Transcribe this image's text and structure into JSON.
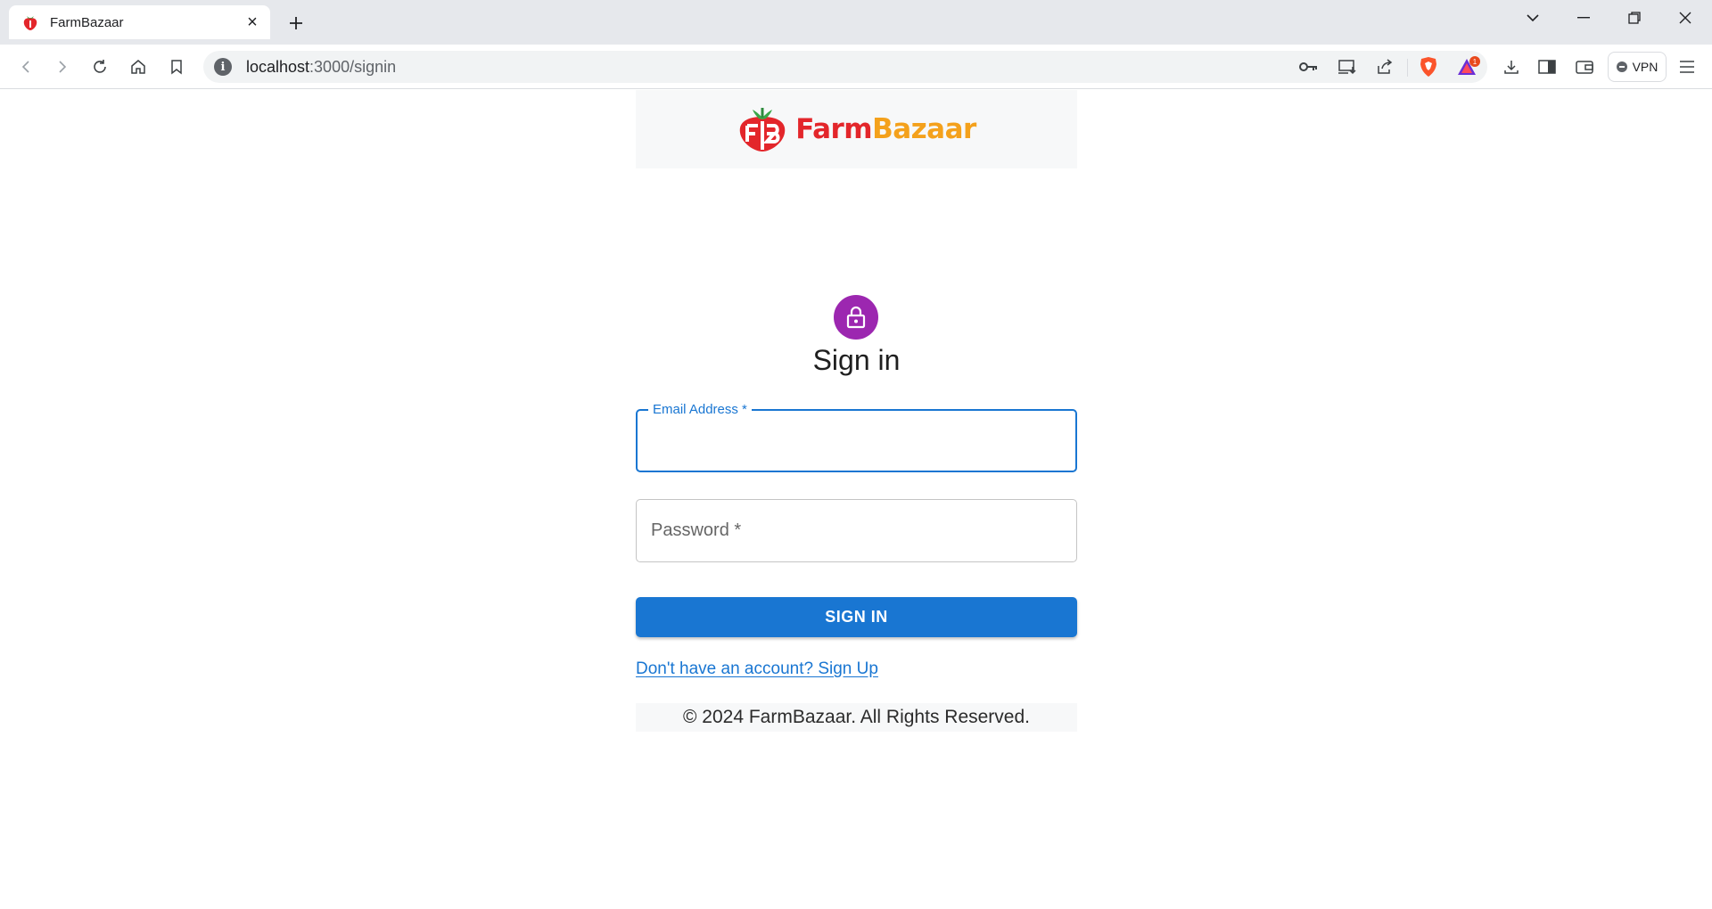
{
  "browser": {
    "tab_title": "FarmBazaar",
    "url_host": "localhost",
    "url_path": ":3000/signin",
    "vpn_label": "VPN",
    "rewards_badge": "1"
  },
  "header": {
    "logo_farm": "Farm",
    "logo_bazaar": "Bazaar"
  },
  "form": {
    "heading": "Sign in",
    "email_label": "Email Address *",
    "email_value": "",
    "password_placeholder": "Password *",
    "submit_label": "SIGN IN",
    "signup_link": "Don't have an account? Sign Up"
  },
  "footer": {
    "copyright": "© 2024 FarmBazaar. All Rights Reserved."
  },
  "colors": {
    "primary": "#1976d2",
    "avatar": "#9c27b0",
    "logo_red": "#e3262b",
    "logo_orange": "#f4a11c"
  }
}
